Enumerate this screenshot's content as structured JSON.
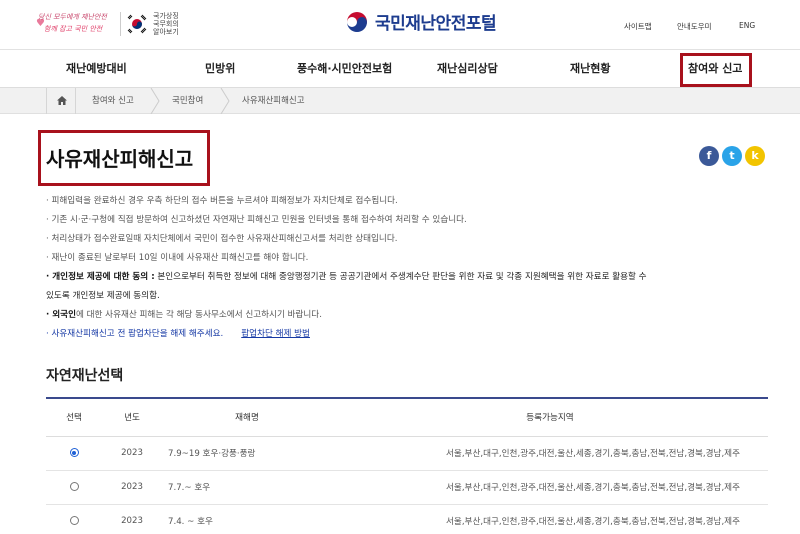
{
  "header": {
    "slogan_line1": "당신 모두에게 재난안전",
    "slogan_line2": "함께 잡고 국민 안전",
    "gov_text": "국가상징 국무회의 알아보기",
    "portal_title": "국민재난안전포털",
    "utility_links": [
      "사이트맵",
      "안내도우미",
      "ENG"
    ]
  },
  "nav": {
    "items": [
      "재난예방대비",
      "민방위",
      "풍수해·시민안전보험",
      "재난심리상담",
      "재난현황",
      "참여와 신고"
    ]
  },
  "breadcrumb": {
    "items": [
      "참여와 신고",
      "국민참여",
      "사유재산피해신고"
    ]
  },
  "page": {
    "title": "사유재산피해신고"
  },
  "sns": {
    "facebook": "f",
    "twitter": "t",
    "kakao": "k",
    "colors": {
      "facebook": "#3b5998",
      "twitter": "#2aa3e8",
      "kakao": "#f2c400"
    }
  },
  "notices": {
    "n1": "· 피해입력을 완료하신 경우 우측 하단의 접수 버튼을 누르셔야 피해정보가 자치단체로 접수됩니다.",
    "n2": "· 기존 시·군·구청에 직접 방문하여 신고하셨던 자연재난 피해신고 민원을 인터넷을 통해 접수하여 처리할 수 있습니다.",
    "n3": "· 처리상태가 접수완료일때 자치단체에서 국민이 접수한 사유재산피해신고서를 처리한 상태입니다.",
    "n4": "· 재난이 종료된 날로부터 10일 이내에 사유재산 피해신고를 해야 합니다.",
    "n5_bold": "· 개인정보 제공에 대한 동의 :",
    "n5_rest": " 본인으로부터 취득한 정보에 대해 중앙행정기관 등 공공기관에서 주생계수단 판단을 위한 자료 및 각종 지원혜택을 위한 자료로 활용할 수",
    "n5_cont": "있도록 개인정보 제공에 동의함.",
    "n6_bold": "· 외국인",
    "n6_rest": "에 대한 사유재산 피해는 각 해당 동사무소에서 신고하시기 바랍니다.",
    "n7": "· 사유재산피해신고 전 팝업차단을 해제 해주세요.",
    "n7_link": "팝업차단 해제 방법"
  },
  "disaster_select": {
    "title": "자연재난선택",
    "columns": [
      "선택",
      "년도",
      "재해명",
      "등록가능지역"
    ],
    "rows": [
      {
        "selected": true,
        "year": "2023",
        "name": "7.9~19 호우·강풍·풍랑",
        "regions": "서울,부산,대구,인천,광주,대전,울산,세종,경기,충북,충남,전북,전남,경북,경남,제주"
      },
      {
        "selected": false,
        "year": "2023",
        "name": "7.7.~ 호우",
        "regions": "서울,부산,대구,인천,광주,대전,울산,세종,경기,충북,충남,전북,전남,경북,경남,제주"
      },
      {
        "selected": false,
        "year": "2023",
        "name": "7.4. ~ 호우",
        "regions": "서울,부산,대구,인천,광주,대전,울산,세종,경기,충북,충남,전북,전남,경북,경남,제주"
      }
    ]
  }
}
